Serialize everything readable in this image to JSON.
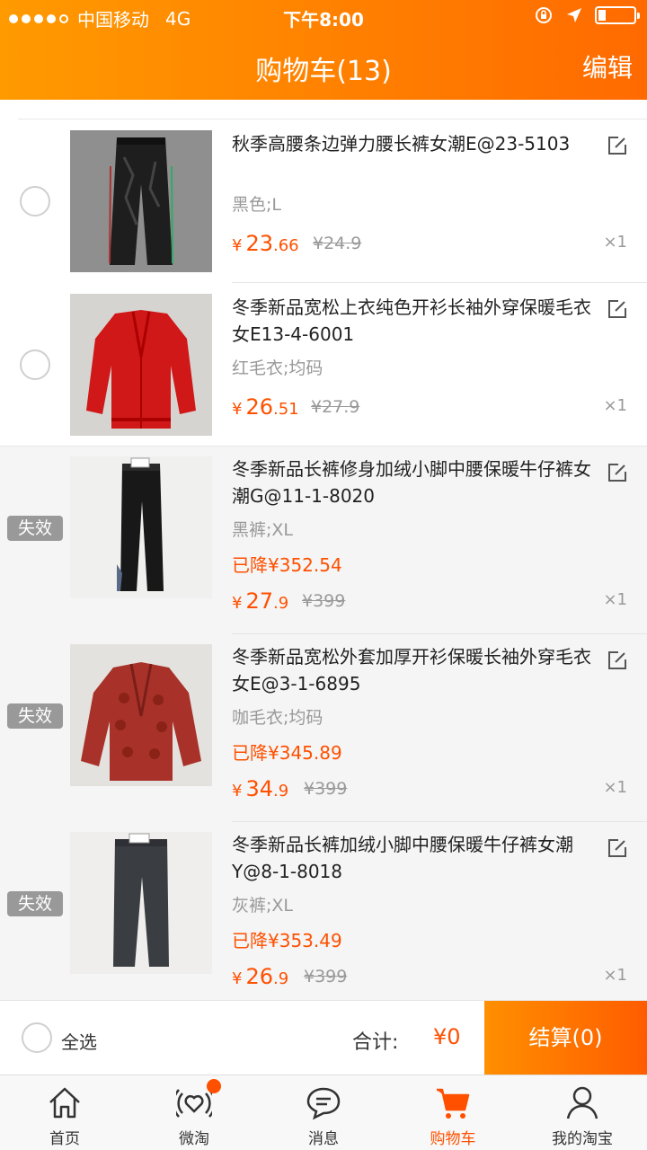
{
  "statusbar": {
    "carrier": "中国移动",
    "network": "4G",
    "time": "下午8:00"
  },
  "header": {
    "title": "购物车(13)",
    "edit": "编辑"
  },
  "items": [
    {
      "name": "秋季高腰条边弹力腰长裤女潮E@23-5103",
      "sku": "黑色;L",
      "price_int": "23",
      "price_dec": ".66",
      "orig": "¥24.9",
      "qty": "×1",
      "invalid": false
    },
    {
      "name": "冬季新品宽松上衣纯色开衫长袖外穿保暖毛衣女E13-4-6001",
      "sku": "红毛衣;均码",
      "price_int": "26",
      "price_dec": ".51",
      "orig": "¥27.9",
      "qty": "×1",
      "invalid": false
    },
    {
      "name": "冬季新品长裤修身加绒小脚中腰保暖牛仔裤女潮G@11-1-8020",
      "sku": "黑裤;XL",
      "drop": "已降¥352.54",
      "price_int": "27",
      "price_dec": ".9",
      "orig": "¥399",
      "qty": "×1",
      "invalid": true,
      "badge": "失效"
    },
    {
      "name": "冬季新品宽松外套加厚开衫保暖长袖外穿毛衣女E@3-1-6895",
      "sku": "咖毛衣;均码",
      "drop": "已降¥345.89",
      "price_int": "34",
      "price_dec": ".9",
      "orig": "¥399",
      "qty": "×1",
      "invalid": true,
      "badge": "失效"
    },
    {
      "name": "冬季新品长裤加绒小脚中腰保暖牛仔裤女潮Y@8-1-8018",
      "sku": "灰裤;XL",
      "drop": "已降¥353.49",
      "price_int": "26",
      "price_dec": ".9",
      "orig": "¥399",
      "qty": "×1",
      "invalid": true,
      "badge": "失效"
    }
  ],
  "currency": "¥",
  "footer": {
    "select_all": "全选",
    "total_label": "合计:",
    "total_value": "¥0",
    "checkout": "结算(0)"
  },
  "tabs": [
    {
      "label": "首页",
      "icon": "home-icon"
    },
    {
      "label": "微淘",
      "icon": "heart-wave-icon"
    },
    {
      "label": "消息",
      "icon": "chat-bubble-icon"
    },
    {
      "label": "购物车",
      "icon": "cart-icon"
    },
    {
      "label": "我的淘宝",
      "icon": "person-icon"
    }
  ],
  "colors": {
    "accent": "#ff5000",
    "header_start": "#ff9a00",
    "header_end": "#ff6a00"
  }
}
